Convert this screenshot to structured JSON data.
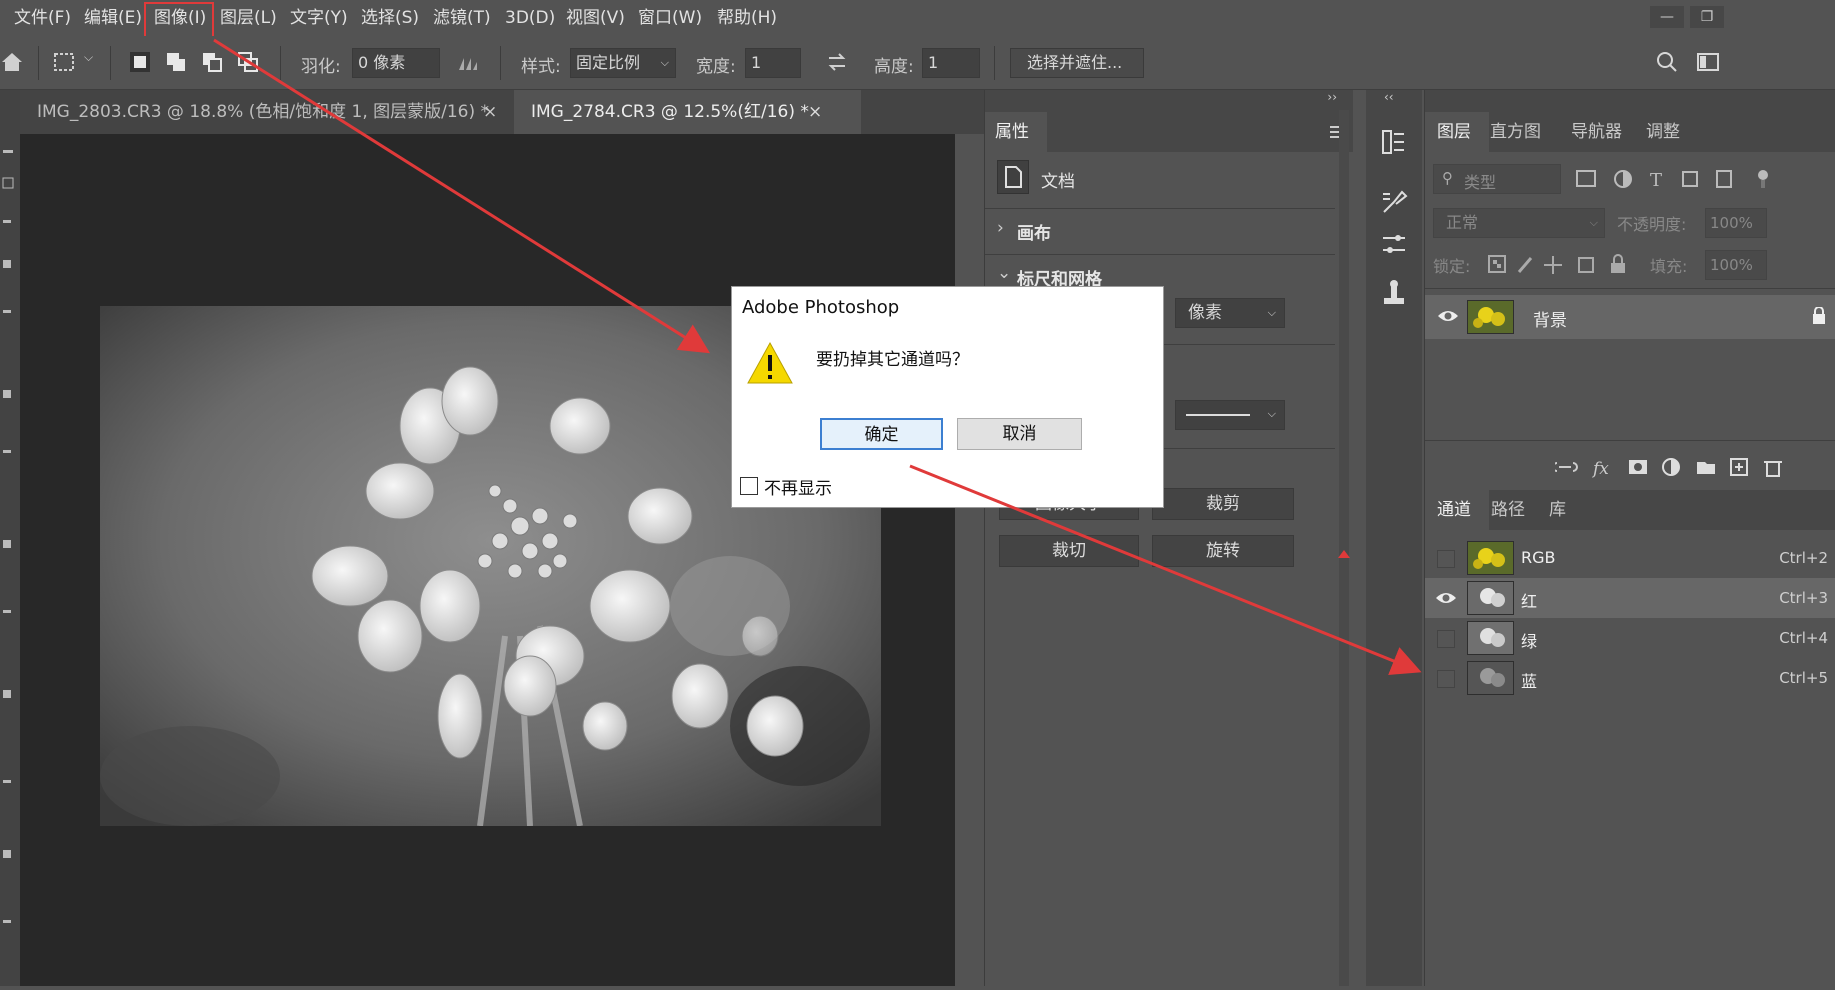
{
  "menu": {
    "items": [
      "文件(F)",
      "编辑(E)",
      "图像(I)",
      "图层(L)",
      "文字(Y)",
      "选择(S)",
      "滤镜(T)",
      "3D(D)",
      "视图(V)",
      "窗口(W)",
      "帮助(H)"
    ]
  },
  "options": {
    "feather_label": "羽化:",
    "feather_value": "0 像素",
    "style_label": "样式:",
    "style_value": "固定比例",
    "width_label": "宽度:",
    "width_value": "1",
    "height_label": "高度:",
    "height_value": "1",
    "select_mask_button": "选择并遮住..."
  },
  "doc_tabs": [
    {
      "label": "IMG_2803.CR3 @ 18.8% (色相/饱和度 1, 图层蒙版/16) *",
      "close": "×"
    },
    {
      "label": "IMG_2784.CR3 @ 12.5%(红/16) *",
      "close": "×"
    }
  ],
  "properties": {
    "tab": "属性",
    "doc_label": "文档",
    "canvas_section": "画布",
    "rulers_section": "标尺和网格",
    "unit_value": "像素",
    "buttons": [
      "图像大小",
      "裁剪",
      "裁切",
      "旋转"
    ]
  },
  "layers_panel": {
    "tabs": [
      "图层",
      "直方图",
      "导航器",
      "调整"
    ],
    "filter_placeholder": "类型",
    "blend_mode": "正常",
    "opacity_label": "不透明度:",
    "opacity_value": "100%",
    "lock_label": "锁定:",
    "fill_label": "填充:",
    "fill_value": "100%",
    "layer_name": "背景"
  },
  "channels_panel": {
    "tabs": [
      "通道",
      "路径",
      "库"
    ],
    "channels": [
      {
        "name": "RGB",
        "shortcut": "Ctrl+2",
        "visible": false
      },
      {
        "name": "红",
        "shortcut": "Ctrl+3",
        "visible": true
      },
      {
        "name": "绿",
        "shortcut": "Ctrl+4",
        "visible": false
      },
      {
        "name": "蓝",
        "shortcut": "Ctrl+5",
        "visible": false
      }
    ]
  },
  "dialog": {
    "title": "Adobe Photoshop",
    "message": "要扔掉其它通道吗？",
    "ok_label": "确定",
    "cancel_label": "取消",
    "checkbox_label": "不再显示"
  },
  "colors": {
    "annotation_red": "#e03a3a",
    "warning_yellow": "#f5d800",
    "panel_bg": "#535353"
  }
}
